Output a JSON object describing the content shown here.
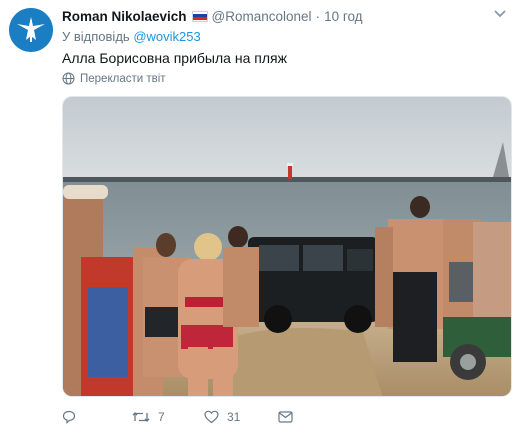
{
  "author": {
    "name": "Roman Nikolaevich",
    "flag_colors": [
      "#ffffff",
      "#1c3fa8",
      "#d52b1e"
    ],
    "handle": "@Romancolonel",
    "time": "10 год"
  },
  "reply": {
    "prefix": "У відповідь",
    "mention": "@wovik253"
  },
  "tweet_text": "Алла Борисовна прибыла на пляж",
  "translate_label": "Перекласти твіт",
  "media": {
    "alt": "beach-photo"
  },
  "actions": {
    "reply_count": "",
    "retweet_count": "7",
    "like_count": "31"
  },
  "colors": {
    "link": "#1b95e0",
    "muted": "#657786",
    "avatar_bg": "#1b7ec2"
  }
}
